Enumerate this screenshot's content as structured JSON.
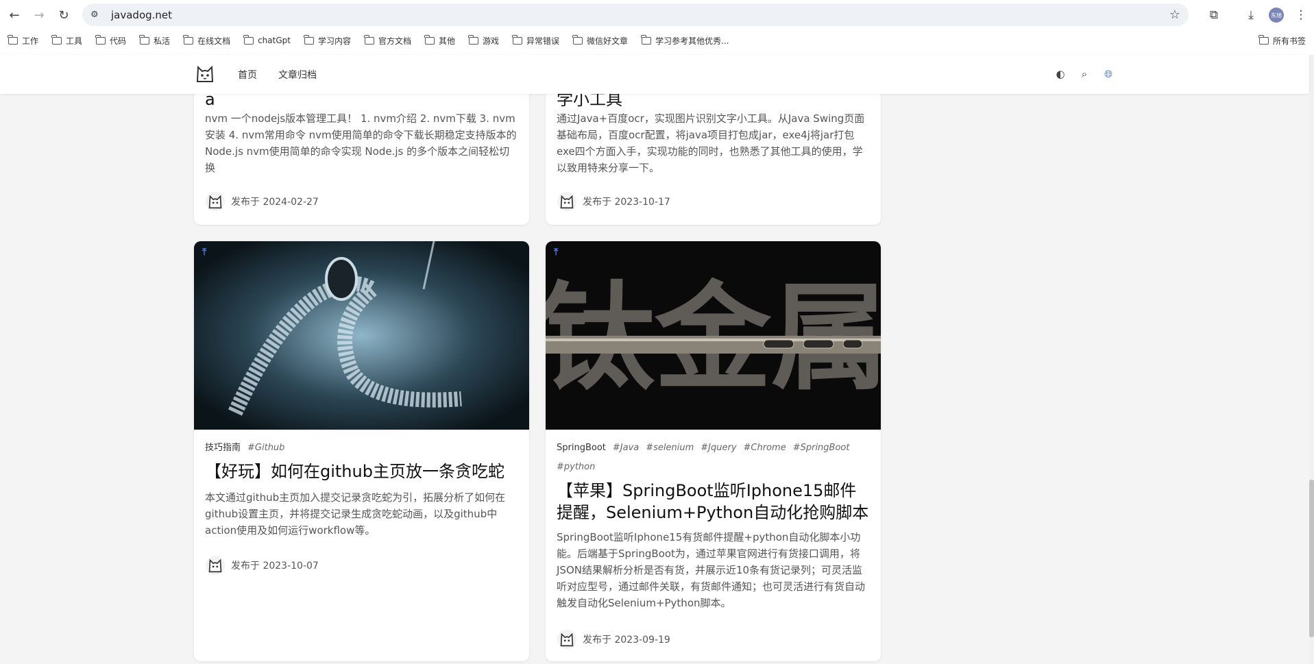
{
  "browser": {
    "url": "javadog.net",
    "profile_label": "东旭",
    "bookmarks": [
      "工作",
      "工具",
      "代码",
      "私活",
      "在线文档",
      "chatGpt",
      "学习内容",
      "官方文档",
      "其他",
      "游戏",
      "异常错误",
      "微信好文章",
      "学习参考其他优秀..."
    ],
    "all_bookmarks": "所有书签"
  },
  "site": {
    "nav": [
      "首页",
      "文章归档"
    ]
  },
  "cards": [
    {
      "title_partial": "a",
      "desc": "nvm 一个nodejs版本管理工具！ 1. nvm介绍 2. nvm下载 3. nvm安装 4. nvm常用命令 nvm使用简单的命令下载长期稳定支持版本的 Node.js nvm使用简单的命令实现 Node.js 的多个版本之间轻松切换",
      "date": "发布于 2024-02-27"
    },
    {
      "title_partial": "学小工具",
      "desc": "通过Java+百度ocr，实现图片识别文字小工具。从Java Swing页面基础布局，百度ocr配置，将java项目打包成jar，exe4j将jar打包exe四个方面入手，实现功能的同时，也熟悉了其他工具的使用，学以致用特来分享一下。",
      "date": "发布于 2023-10-17"
    },
    {
      "category": "技巧指南",
      "tags": [
        "#Github"
      ],
      "title": "【好玩】如何在github主页放一条贪吃蛇",
      "desc": "本文通过github主页加入提交记录贪吃蛇为引，拓展分析了如何在github设置主页，并将提交记录生成贪吃蛇动画，以及github中action使用及如何运行workflow等。",
      "date": "发布于 2023-10-07"
    },
    {
      "category": "SpringBoot",
      "tags": [
        "#Java",
        "#selenium",
        "#Jquery",
        "#Chrome",
        "#SpringBoot",
        "#python"
      ],
      "title": "【苹果】SpringBoot监听Iphone15邮件提醒，Selenium+Python自动化抢购脚本",
      "desc": "SpringBoot监听Iphone15有货邮件提醒+python自动化脚本小功能。后端基于SpringBoot为，通过苹果官网进行有货接口调用，将JSON结果解析分析是否有货，并展示近10条有货记录列；可灵活监听对应型号，通过邮件关联，有货邮件通知；也可灵活进行有货自动触发自动化Selenium+Python脚本。",
      "date": "发布于 2023-09-19",
      "image_text": "钛金属"
    }
  ]
}
